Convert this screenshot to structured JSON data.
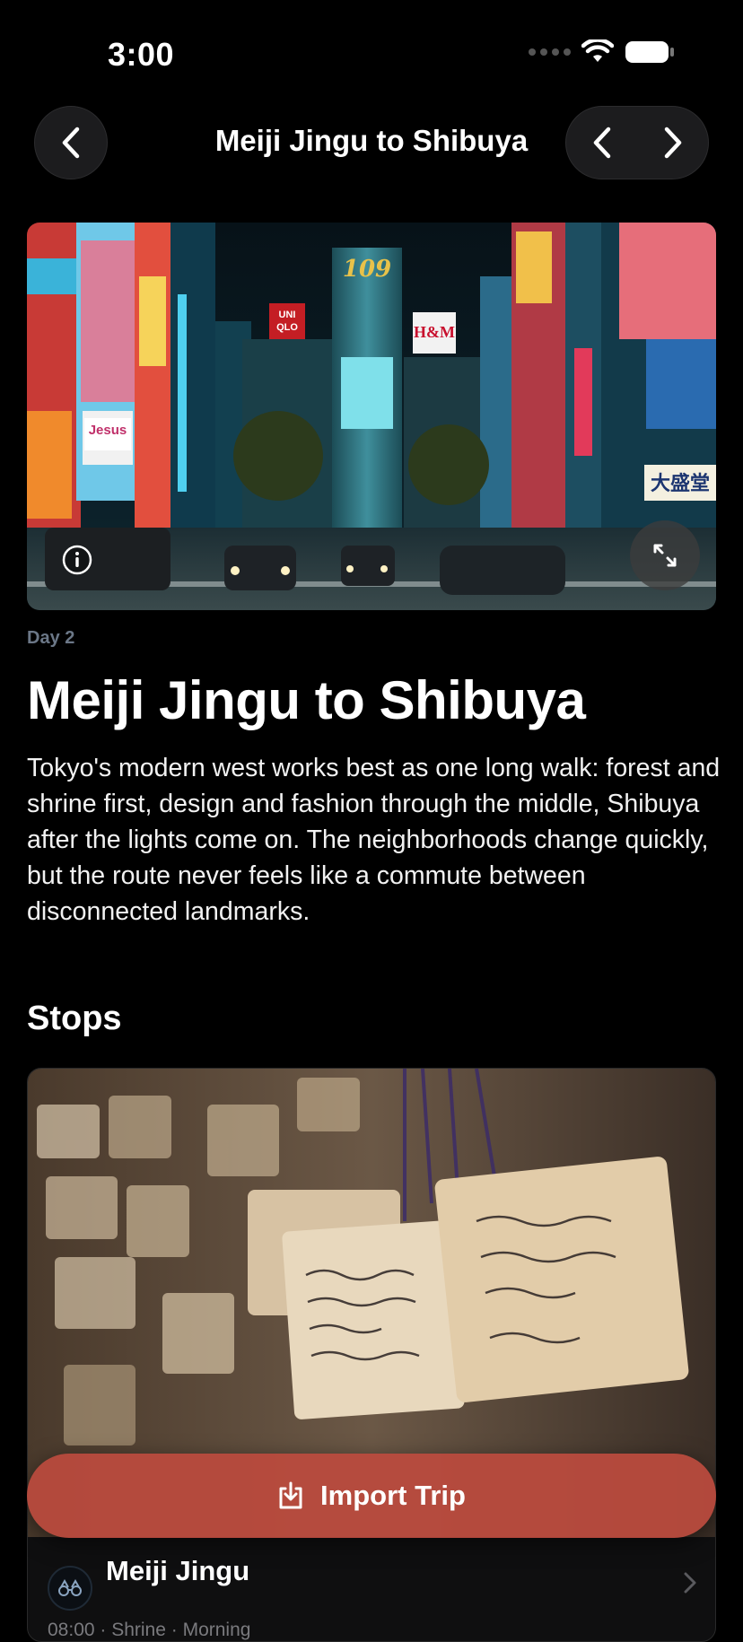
{
  "status_bar": {
    "time": "3:00"
  },
  "nav": {
    "title": "Meiji Jingu to Shibuya",
    "back_icon": "chevron-left-icon",
    "prev_icon": "chevron-left-icon",
    "next_icon": "chevron-right-icon"
  },
  "hero": {
    "info_icon": "info-icon",
    "expand_icon": "expand-icon",
    "sign_texts": [
      "109",
      "UNI QLO",
      "H&M",
      "Jesus",
      "大盛堂"
    ]
  },
  "day_label": "Day 2",
  "page_title": "Meiji Jingu to Shibuya",
  "description": "Tokyo's modern west works best as one long walk: forest and shrine first, design and fashion through the middle, Shibuya after the lights come on. The neighborhoods change quickly, but the route never feels like a commute between disconnected landmarks.",
  "stops": {
    "section_title": "Stops",
    "items": [
      {
        "name": "Meiji Jingu",
        "meta": "08:00 · Shrine · Morning",
        "icon": "binoculars-icon"
      }
    ]
  },
  "import_button": {
    "label": "Import Trip",
    "icon": "download-icon",
    "color": "#BA4A3E"
  },
  "colors": {
    "background": "#000000",
    "day_label": "#6B7787",
    "accent": "#BA4A3E"
  }
}
